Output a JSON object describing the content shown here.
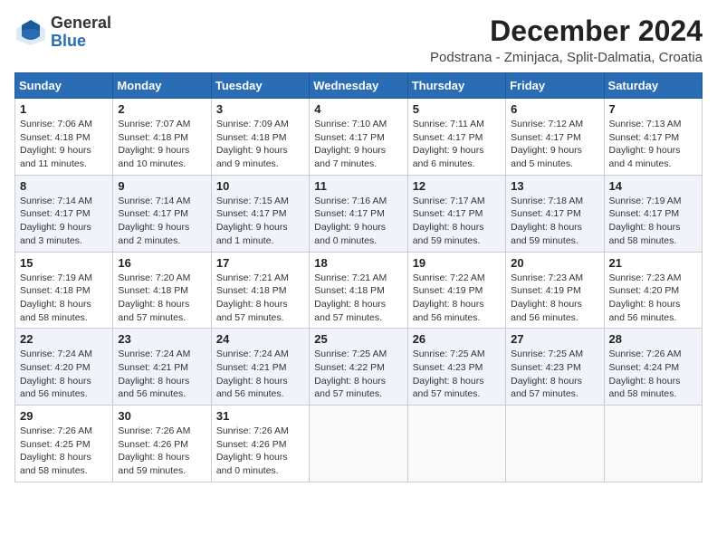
{
  "header": {
    "logo_general": "General",
    "logo_blue": "Blue",
    "month_title": "December 2024",
    "location": "Podstrana - Zminjaca, Split-Dalmatia, Croatia"
  },
  "weekdays": [
    "Sunday",
    "Monday",
    "Tuesday",
    "Wednesday",
    "Thursday",
    "Friday",
    "Saturday"
  ],
  "weeks": [
    [
      {
        "day": "1",
        "sunrise": "7:06 AM",
        "sunset": "4:18 PM",
        "daylight": "9 hours and 11 minutes."
      },
      {
        "day": "2",
        "sunrise": "7:07 AM",
        "sunset": "4:18 PM",
        "daylight": "9 hours and 10 minutes."
      },
      {
        "day": "3",
        "sunrise": "7:09 AM",
        "sunset": "4:18 PM",
        "daylight": "9 hours and 9 minutes."
      },
      {
        "day": "4",
        "sunrise": "7:10 AM",
        "sunset": "4:17 PM",
        "daylight": "9 hours and 7 minutes."
      },
      {
        "day": "5",
        "sunrise": "7:11 AM",
        "sunset": "4:17 PM",
        "daylight": "9 hours and 6 minutes."
      },
      {
        "day": "6",
        "sunrise": "7:12 AM",
        "sunset": "4:17 PM",
        "daylight": "9 hours and 5 minutes."
      },
      {
        "day": "7",
        "sunrise": "7:13 AM",
        "sunset": "4:17 PM",
        "daylight": "9 hours and 4 minutes."
      }
    ],
    [
      {
        "day": "8",
        "sunrise": "7:14 AM",
        "sunset": "4:17 PM",
        "daylight": "9 hours and 3 minutes."
      },
      {
        "day": "9",
        "sunrise": "7:14 AM",
        "sunset": "4:17 PM",
        "daylight": "9 hours and 2 minutes."
      },
      {
        "day": "10",
        "sunrise": "7:15 AM",
        "sunset": "4:17 PM",
        "daylight": "9 hours and 1 minute."
      },
      {
        "day": "11",
        "sunrise": "7:16 AM",
        "sunset": "4:17 PM",
        "daylight": "9 hours and 0 minutes."
      },
      {
        "day": "12",
        "sunrise": "7:17 AM",
        "sunset": "4:17 PM",
        "daylight": "8 hours and 59 minutes."
      },
      {
        "day": "13",
        "sunrise": "7:18 AM",
        "sunset": "4:17 PM",
        "daylight": "8 hours and 59 minutes."
      },
      {
        "day": "14",
        "sunrise": "7:19 AM",
        "sunset": "4:17 PM",
        "daylight": "8 hours and 58 minutes."
      }
    ],
    [
      {
        "day": "15",
        "sunrise": "7:19 AM",
        "sunset": "4:18 PM",
        "daylight": "8 hours and 58 minutes."
      },
      {
        "day": "16",
        "sunrise": "7:20 AM",
        "sunset": "4:18 PM",
        "daylight": "8 hours and 57 minutes."
      },
      {
        "day": "17",
        "sunrise": "7:21 AM",
        "sunset": "4:18 PM",
        "daylight": "8 hours and 57 minutes."
      },
      {
        "day": "18",
        "sunrise": "7:21 AM",
        "sunset": "4:18 PM",
        "daylight": "8 hours and 57 minutes."
      },
      {
        "day": "19",
        "sunrise": "7:22 AM",
        "sunset": "4:19 PM",
        "daylight": "8 hours and 56 minutes."
      },
      {
        "day": "20",
        "sunrise": "7:23 AM",
        "sunset": "4:19 PM",
        "daylight": "8 hours and 56 minutes."
      },
      {
        "day": "21",
        "sunrise": "7:23 AM",
        "sunset": "4:20 PM",
        "daylight": "8 hours and 56 minutes."
      }
    ],
    [
      {
        "day": "22",
        "sunrise": "7:24 AM",
        "sunset": "4:20 PM",
        "daylight": "8 hours and 56 minutes."
      },
      {
        "day": "23",
        "sunrise": "7:24 AM",
        "sunset": "4:21 PM",
        "daylight": "8 hours and 56 minutes."
      },
      {
        "day": "24",
        "sunrise": "7:24 AM",
        "sunset": "4:21 PM",
        "daylight": "8 hours and 56 minutes."
      },
      {
        "day": "25",
        "sunrise": "7:25 AM",
        "sunset": "4:22 PM",
        "daylight": "8 hours and 57 minutes."
      },
      {
        "day": "26",
        "sunrise": "7:25 AM",
        "sunset": "4:23 PM",
        "daylight": "8 hours and 57 minutes."
      },
      {
        "day": "27",
        "sunrise": "7:25 AM",
        "sunset": "4:23 PM",
        "daylight": "8 hours and 57 minutes."
      },
      {
        "day": "28",
        "sunrise": "7:26 AM",
        "sunset": "4:24 PM",
        "daylight": "8 hours and 58 minutes."
      }
    ],
    [
      {
        "day": "29",
        "sunrise": "7:26 AM",
        "sunset": "4:25 PM",
        "daylight": "8 hours and 58 minutes."
      },
      {
        "day": "30",
        "sunrise": "7:26 AM",
        "sunset": "4:26 PM",
        "daylight": "8 hours and 59 minutes."
      },
      {
        "day": "31",
        "sunrise": "7:26 AM",
        "sunset": "4:26 PM",
        "daylight": "9 hours and 0 minutes."
      },
      null,
      null,
      null,
      null
    ]
  ]
}
